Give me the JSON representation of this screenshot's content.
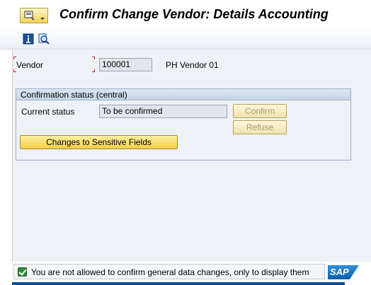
{
  "window": {
    "title": "Confirm Change Vendor: Details Accounting"
  },
  "toolbar": {
    "icons": [
      "info-icon",
      "find-icon"
    ]
  },
  "vendor": {
    "label": "Vendor",
    "value": "100001",
    "name": "PH Vendor 01"
  },
  "confirmation_group": {
    "title": "Confirmation status (central)",
    "current_status_label": "Current status",
    "current_status_value": "To be confirmed",
    "confirm_label": "Confirm",
    "refuse_label": "Refuse",
    "sensitive_fields_label": "Changes to Sensitive Fields"
  },
  "status_bar": {
    "message": "You are not allowed to confirm general data changes, only to display them",
    "type": "success",
    "logo": "SAP"
  },
  "colors": {
    "accent_button": "#f5cf47",
    "status_icon": "#2e8b3a",
    "group_header": "#c5d4e8"
  }
}
